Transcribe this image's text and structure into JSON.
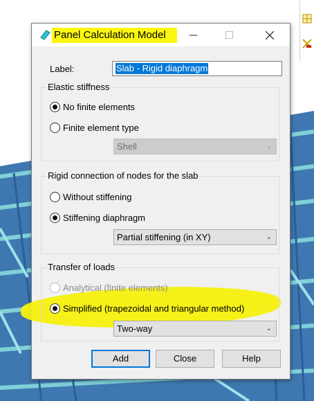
{
  "dialog": {
    "title": "Panel Calculation Model",
    "label_caption": "Label:",
    "label_value": "Slab - Rigid diaphragm"
  },
  "elastic": {
    "title": "Elastic stiffness",
    "option1": "No finite elements",
    "option2": "Finite element type",
    "combo": "Shell"
  },
  "rigid": {
    "title": "Rigid connection of nodes for the slab",
    "option1": "Without stiffening",
    "option2": "Stiffening diaphragm",
    "combo": "Partial stiffening (in XY)"
  },
  "transfer": {
    "title": "Transfer of loads",
    "option1": "Analytical (finite elements)",
    "option2": "Simplified (trapezoidal and triangular method)",
    "combo": "Two-way"
  },
  "buttons": {
    "add": "Add",
    "close": "Close",
    "help": "Help"
  },
  "colors": {
    "highlight": "#fbf70f",
    "selection": "#0078d7"
  },
  "icons": [
    "panel-icon",
    "minimize-icon",
    "maximize-icon",
    "close-icon",
    "chevron-down-icon"
  ]
}
